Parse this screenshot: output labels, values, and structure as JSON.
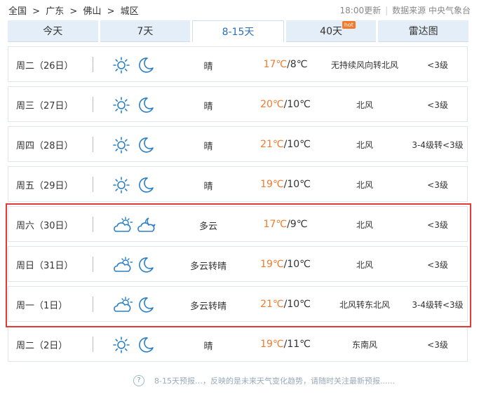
{
  "breadcrumb": [
    "全国",
    ">",
    "广东",
    ">",
    "佛山",
    ">",
    "城区"
  ],
  "source": {
    "updated": "18:00更新",
    "label": "数据来源 中央气象台"
  },
  "tabs": [
    {
      "label": "今天"
    },
    {
      "label": "7天"
    },
    {
      "label": "8-15天"
    },
    {
      "label": "40天",
      "badge": "hot"
    },
    {
      "label": "雷达图"
    }
  ],
  "active_tab": "8-15天",
  "colors": {
    "high_temp": "#f07a2a",
    "icon": "#2a7fc9",
    "highlight_border": "#e53935"
  },
  "forecast": [
    {
      "day": "周二（26日）",
      "day_icon": "sun-icon",
      "night_icon": "moon-icon",
      "weather": "晴",
      "high": "17℃",
      "low": "/8℃",
      "wind": "无持续风向转北风",
      "level": "<3级"
    },
    {
      "day": "周三（27日）",
      "day_icon": "sun-icon",
      "night_icon": "moon-icon",
      "weather": "晴",
      "high": "20℃",
      "low": "/10℃",
      "wind": "北风",
      "level": "<3级"
    },
    {
      "day": "周四（28日）",
      "day_icon": "sun-icon",
      "night_icon": "moon-icon",
      "weather": "晴",
      "high": "21℃",
      "low": "/10℃",
      "wind": "北风",
      "level": "3-4级转<3级"
    },
    {
      "day": "周五（29日）",
      "day_icon": "sun-icon",
      "night_icon": "moon-icon",
      "weather": "晴",
      "high": "19℃",
      "low": "/10℃",
      "wind": "北风",
      "level": "<3级"
    },
    {
      "day": "周六（30日）",
      "day_icon": "partly-cloudy-icon",
      "night_icon": "cloudy-night-icon",
      "weather": "多云",
      "high": "17℃",
      "low": "/9℃",
      "wind": "北风",
      "level": "<3级"
    },
    {
      "day": "周日（31日）",
      "day_icon": "partly-cloudy-icon",
      "night_icon": "moon-icon",
      "weather": "多云转晴",
      "high": "19℃",
      "low": "/10℃",
      "wind": "北风",
      "level": "<3级"
    },
    {
      "day": "周一（1日）",
      "day_icon": "partly-cloudy-icon",
      "night_icon": "moon-icon",
      "weather": "多云转晴",
      "high": "21℃",
      "low": "/10℃",
      "wind": "北风转东北风",
      "level": "3-4级转<3级"
    },
    {
      "day": "周二（2日）",
      "day_icon": "sun-icon",
      "night_icon": "moon-icon",
      "weather": "晴",
      "high": "19℃",
      "low": "/11℃",
      "wind": "东南风",
      "level": "<3级"
    }
  ],
  "footer": {
    "note": "8-15天预报…，反映的是未来天气变化趋势，请随时关注最新预报......"
  }
}
